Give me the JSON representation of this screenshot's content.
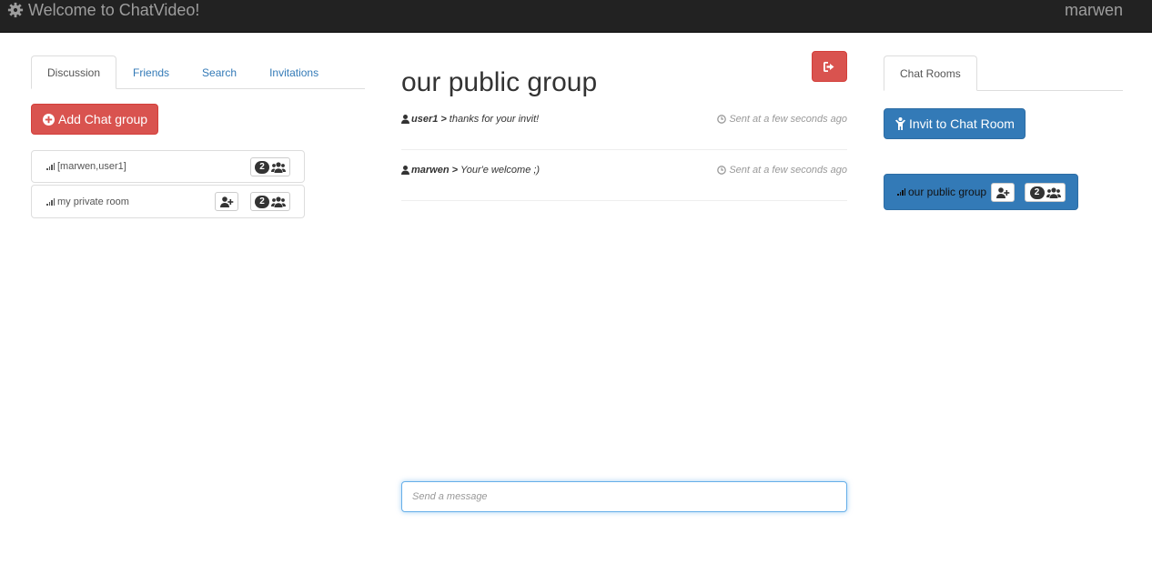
{
  "navbar": {
    "brand": "Welcome to ChatVideo!",
    "user": "marwen"
  },
  "left_panel": {
    "tabs": [
      {
        "label": "Discussion",
        "active": true
      },
      {
        "label": "Friends",
        "active": false
      },
      {
        "label": "Search",
        "active": false
      },
      {
        "label": "Invitations",
        "active": false
      }
    ],
    "add_group_label": "Add Chat group",
    "rooms": [
      {
        "name": "[marwen,user1]",
        "members": "2",
        "can_invite": false
      },
      {
        "name": "my private room",
        "members": "2",
        "can_invite": true
      }
    ]
  },
  "chat": {
    "title": "our public group",
    "messages": [
      {
        "user": "user1",
        "separator": ">",
        "text": "thanks for your invit!",
        "time": "Sent at a few seconds ago"
      },
      {
        "user": "marwen",
        "separator": ">",
        "text": "Your'e welcome ;)",
        "time": "Sent at a few seconds ago"
      }
    ],
    "input_placeholder": "Send a message"
  },
  "right_panel": {
    "tab_label": "Chat Rooms",
    "invite_label": "Invit to Chat Room",
    "active_room": {
      "name": "our public group",
      "members": "2"
    }
  },
  "colors": {
    "navbar_bg": "#222222",
    "danger": "#d9534f",
    "primary": "#337ab7",
    "link": "#337ab7"
  }
}
